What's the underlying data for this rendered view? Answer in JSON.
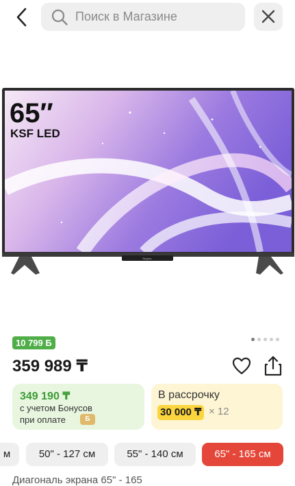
{
  "search": {
    "placeholder": "Поиск в Магазине"
  },
  "product_image": {
    "size_label": "65″",
    "model_label": "KSF LED",
    "brand_label": "Яндекс"
  },
  "gallery": {
    "count": 5,
    "active_index": 0
  },
  "bonus_badge": "10 799 Б",
  "price": "359 989 ₸",
  "bonus_card": {
    "price": "349 190 ₸",
    "line1": "с учетом Бонусов",
    "line2": "при оплате",
    "coin_label": "Б"
  },
  "installment_card": {
    "title": "В рассрочку",
    "amount": "30 000 ₸",
    "multiplier": "× 12"
  },
  "size_chips": [
    {
      "label": "м"
    },
    {
      "label": "50\" - 127 см"
    },
    {
      "label": "55\" - 140 см"
    },
    {
      "label": "65\" - 165 см",
      "selected": true
    }
  ],
  "description_partial": "Диагональ экрана 65\" - 165",
  "colors": {
    "accent_red": "#e4473a",
    "bonus_green": "#4fae47",
    "install_yellow": "#fbd53e"
  }
}
